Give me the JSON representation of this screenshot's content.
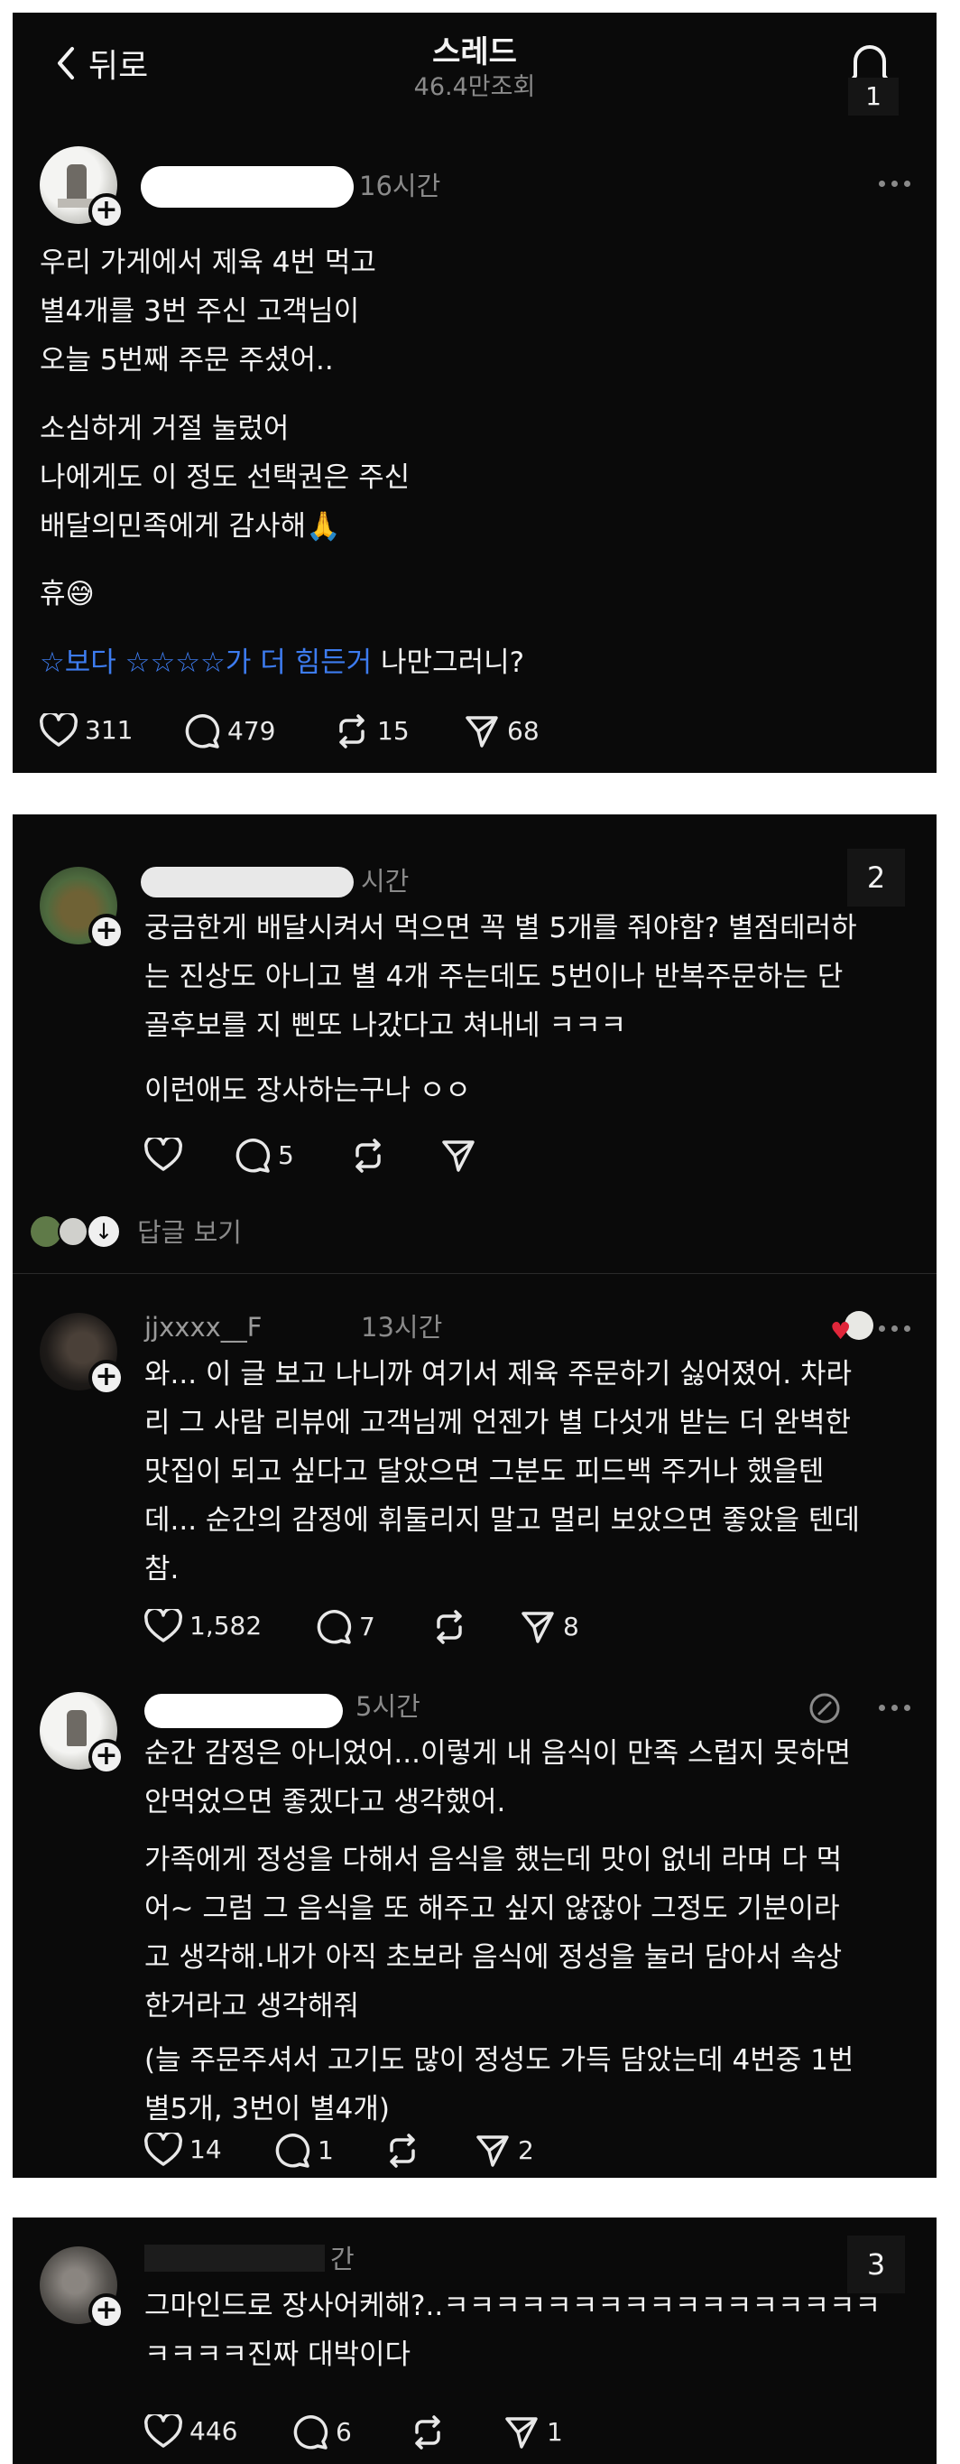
{
  "header": {
    "back_label": "뒤로",
    "title": "스레드",
    "views": "46.4만조회",
    "notification_count": "1"
  },
  "post": {
    "time": "16시간",
    "lines": [
      "우리 가게에서 제육 4번 먹고",
      "별4개를 3번 주신 고객님이",
      "오늘 5번째 주문 주셨어..",
      "소심하게 거절 눌렀어",
      "나에게도 이 정도 선택권은 주신",
      "배달의민족에게 감사해🙏",
      "휴😅"
    ],
    "quote_blue": "☆보다 ☆☆☆☆가 더  힘든거",
    "quote_white": " 나만그러니?",
    "likes": "311",
    "comments": "479",
    "reposts": "15",
    "shares": "68"
  },
  "reply1": {
    "badge": "2",
    "time": "시간",
    "lines": [
      "궁금한게 배달시켜서 먹으면 꼭 별 5개를 줘야함? 별점테러하",
      "는 진상도 아니고 별 4개 주는데도 5번이나 반복주문하는 단",
      "골후보를 지 삔또 나갔다고 쳐내네 ㅋㅋㅋ",
      "이런애도 장사하는구나 ㅇㅇ"
    ],
    "comments": "5",
    "view_replies": "답글 보기"
  },
  "reply2": {
    "username": "jjxxxx__F",
    "time": "13시간",
    "lines": [
      "와... 이 글 보고 나니까 여기서 제육 주문하기 싫어졌어. 차라",
      "리 그 사람 리뷰에 고객님께 언젠가 별 다섯개 받는 더 완벽한",
      "맛집이 되고 싶다고 달았으면 그분도 피드백 주거나 했을텐",
      "데... 순간의 감정에 휘둘리지 말고 멀리 보았으면 좋았을 텐데",
      "참."
    ],
    "likes": "1,582",
    "comments": "7",
    "shares": "8"
  },
  "reply3": {
    "time": "5시간",
    "lines": [
      "순간 감정은 아니었어...이렇게 내 음식이 만족 스럽지 못하면",
      "안먹었으면 좋겠다고 생각했어.",
      "가족에게 정성을 다해서 음식을 했는데 맛이 없네 라며 다 먹",
      "어~ 그럼 그 음식을 또 해주고 싶지 않잖아  그정도 기분이라",
      "고 생각해.내가 아직 초보라 음식에 정성을 눌러 담아서  속상",
      "한거라고 생각해줘",
      "(늘 주문주셔서 고기도 많이 정성도 가득 담았는데 4번중 1번",
      "별5개, 3번이 별4개)"
    ],
    "likes": "14",
    "comments": "1",
    "shares": "2"
  },
  "reply4": {
    "badge": "3",
    "time": "간",
    "lines": [
      "그마인드로 장사어케해?..ㅋㅋㅋㅋㅋㅋㅋㅋㅋㅋㅋㅋㅋㅋㅋㅋㅋ",
      "ㅋㅋㅋㅋ진짜 대박이다"
    ],
    "likes": "446",
    "comments": "6",
    "shares": "1"
  }
}
